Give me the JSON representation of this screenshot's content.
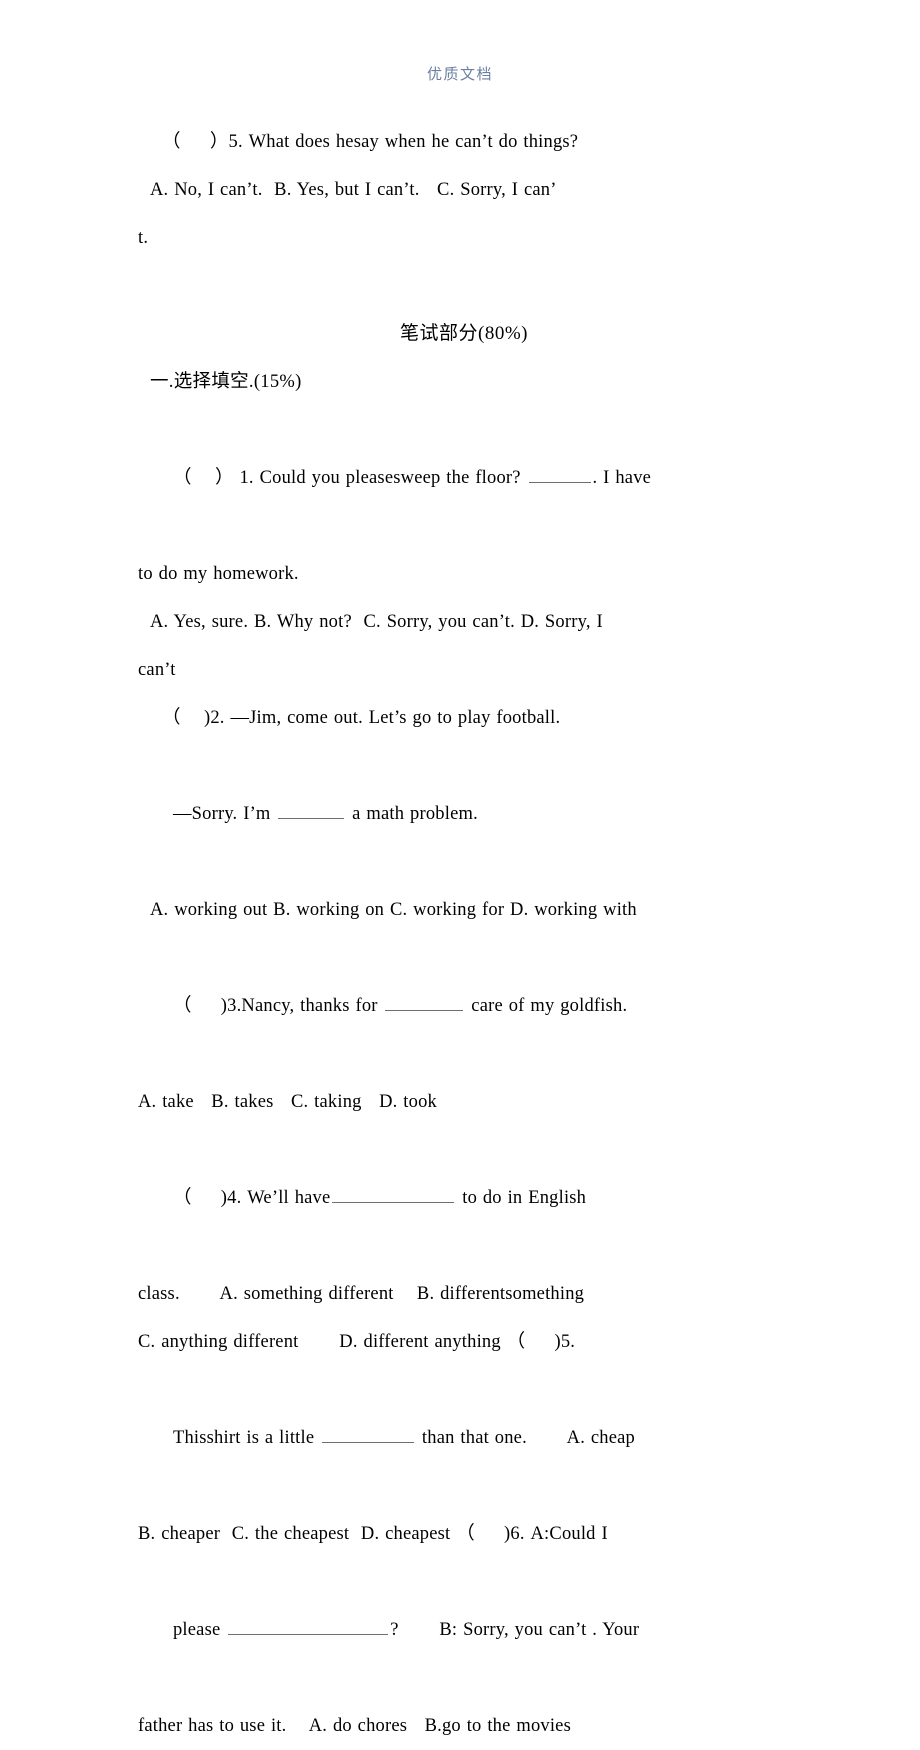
{
  "document": {
    "watermark": "优质文档",
    "listening_tail": {
      "q5_stem": "（     ）5. What does hesay when he can’t do things?",
      "q5_options": "A. No, I can’t.  B. Yes, but I can’t.   C. Sorry, I can’",
      "q5_options_wrap": "t."
    },
    "written_section": {
      "title": "笔试部分(80%)",
      "part_one_title": "一.选择填空.(15%)",
      "questions": [
        {
          "id": "q1",
          "stem_pre": "（    ） 1. Could you pleasesweep the floor? ",
          "stem_post": ". I have",
          "stem_wrap": "to do my homework.",
          "options_line1": "A. Yes, sure. B. Why not?  C. Sorry, you can’t. D. Sorry, I",
          "options_line2": "can’t"
        },
        {
          "id": "q2",
          "stem": "（    )2. —Jim, come out. Let’s go to play football.",
          "stem_pre2": "—Sorry. I’m ",
          "stem_post2": " a math problem.",
          "options": "A. working out B. working on C. working for D. working with"
        },
        {
          "id": "q3",
          "stem_pre": "（     )3.Nancy, thanks for ",
          "stem_post": " care of my goldfish.",
          "options": "A. take   B. takes   C. taking   D. took"
        },
        {
          "id": "q4",
          "stem_pre": "（     )4. We’ll have",
          "stem_post": " to do in English",
          "wrap_line": "class.       A. something different    B. differentsomething",
          "options_tail": "C. anything different       D. different anything （     )5."
        },
        {
          "id": "q5",
          "stem_pre": "Thisshirt is a little ",
          "stem_post": " than that one.       A. cheap",
          "options_tail": "B. cheaper  C. the cheapest  D. cheapest （     )6. A:Could I"
        },
        {
          "id": "q6",
          "stem_pre": "please ",
          "stem_post": "?       B: Sorry, you can’t . Your",
          "wrap_line": "father has to use it.    A. do chores   B.go to the movies"
        }
      ]
    }
  }
}
